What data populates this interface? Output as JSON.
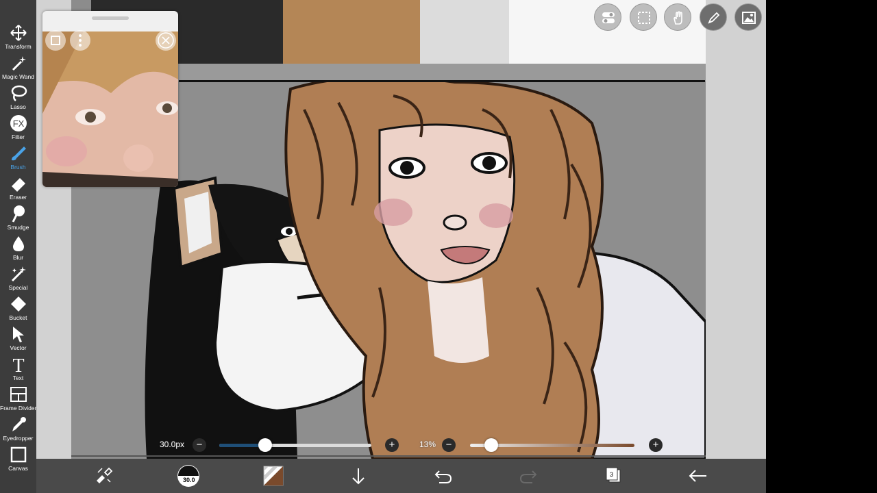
{
  "toolbar": {
    "tools": [
      {
        "label": "Transform",
        "icon": "transform-icon"
      },
      {
        "label": "Magic Wand",
        "icon": "magic-wand-icon"
      },
      {
        "label": "Lasso",
        "icon": "lasso-icon"
      },
      {
        "label": "Filter",
        "icon": "fx-icon"
      },
      {
        "label": "Brush",
        "icon": "brush-icon",
        "active": true
      },
      {
        "label": "Eraser",
        "icon": "eraser-icon"
      },
      {
        "label": "Smudge",
        "icon": "smudge-icon"
      },
      {
        "label": "Blur",
        "icon": "blur-drop-icon"
      },
      {
        "label": "Special",
        "icon": "special-icon"
      },
      {
        "label": "Bucket",
        "icon": "bucket-icon"
      },
      {
        "label": "Vector",
        "icon": "vector-arrow-icon"
      },
      {
        "label": "Text",
        "icon": "text-icon"
      },
      {
        "label": "Frame Divider",
        "icon": "frame-divider-icon"
      },
      {
        "label": "Eyedropper",
        "icon": "eyedropper-icon"
      },
      {
        "label": "Canvas",
        "icon": "canvas-icon"
      }
    ],
    "fx_glyph": "FX",
    "text_glyph": "T",
    "active_color": "#4aa3e8"
  },
  "sliders": {
    "brush_size": "30.0px",
    "brush_size_fraction": 0.3,
    "opacity": "13%",
    "opacity_fraction": 0.13,
    "minus": "−",
    "plus": "+"
  },
  "bottom_bar": {
    "brush_preview_size": "30.0",
    "layer_count": "3",
    "brush_color": "#7a4a2c"
  },
  "top_actions": [
    "layer-toggle-icon",
    "selection-icon",
    "hand-icon",
    "pen-icon",
    "image-icon"
  ]
}
